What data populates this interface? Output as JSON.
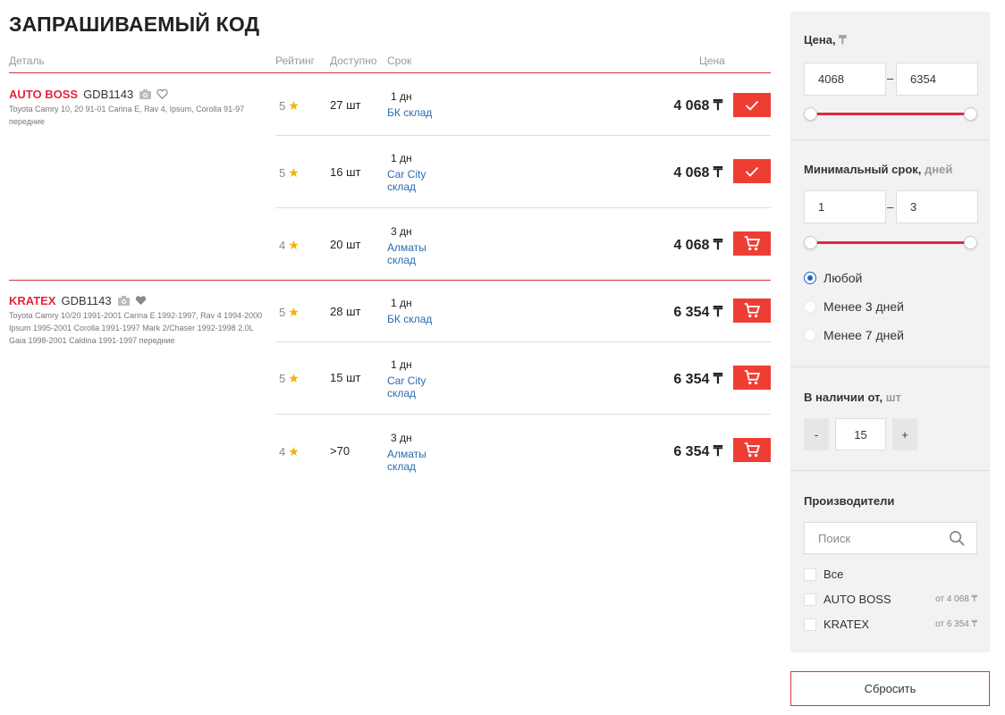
{
  "title": "ЗАПРАШИВАЕМЫЙ КОД",
  "columns": {
    "detail": "Деталь",
    "rating": "Рейтинг",
    "avail": "Доступно",
    "term": "Срок",
    "price": "Цена"
  },
  "brands": [
    {
      "name": "AUTO BOSS",
      "code": "GDB1143",
      "desc": "Toyota Camry 10, 20 91-01 Carina E, Rav 4, Ipsum, Corolla 91-97 передние",
      "offers": [
        {
          "rating": "5",
          "avail": "27 шт",
          "days": "1 дн",
          "warehouse": "БК склад",
          "price": "4 068 ₸",
          "action": "check"
        },
        {
          "rating": "5",
          "avail": "16 шт",
          "days": "1 дн",
          "warehouse": "Car City склад",
          "price": "4 068 ₸",
          "action": "check"
        },
        {
          "rating": "4",
          "avail": "20 шт",
          "days": "3 дн",
          "warehouse": "Алматы склад",
          "price": "4 068 ₸",
          "action": "cart"
        }
      ]
    },
    {
      "name": "KRATEX",
      "code": "GDB1143",
      "desc": "Toyota Camry 10/20 1991-2001 Carina E 1992-1997, Rav 4 1994-2000 Ipsum 1995-2001 Corolla 1991-1997 Mark 2/Chaser 1992-1998 2.0L Gaia 1998-2001 Caldina 1991-1997 передние",
      "offers": [
        {
          "rating": "5",
          "avail": "28 шт",
          "days": "1 дн",
          "warehouse": "БК склад",
          "price": "6 354 ₸",
          "action": "cart"
        },
        {
          "rating": "5",
          "avail": "15 шт",
          "days": "1 дн",
          "warehouse": "Car City склад",
          "price": "6 354 ₸",
          "action": "cart"
        },
        {
          "rating": "4",
          "avail": ">70",
          "days": "3 дн",
          "warehouse": "Алматы склад",
          "price": "6 354 ₸",
          "action": "cart"
        }
      ]
    }
  ],
  "filters": {
    "price": {
      "label": "Цена,",
      "unit": "₸",
      "min": "4068",
      "max": "6354"
    },
    "term": {
      "label": "Минимальный срок,",
      "unit": "дней",
      "min": "1",
      "max": "3",
      "options": [
        "Любой",
        "Менее 3 дней",
        "Менее 7 дней"
      ],
      "selected": 0
    },
    "stock": {
      "label": "В наличии от,",
      "unit": "шт",
      "minus": "-",
      "value": "15",
      "plus": "+"
    },
    "makers": {
      "label": "Производители",
      "search_placeholder": "Поиск",
      "items": [
        {
          "name": "Все",
          "from": ""
        },
        {
          "name": "AUTO BOSS",
          "from": "от 4 068 ₸"
        },
        {
          "name": "KRATEX",
          "from": "от 6 354 ₸"
        }
      ]
    }
  },
  "reset_label": "Сбросить",
  "colors": {
    "accent": "#e3263f",
    "button": "#ee3e34",
    "link": "#2b6cb0",
    "radio": "#1a66c7"
  }
}
